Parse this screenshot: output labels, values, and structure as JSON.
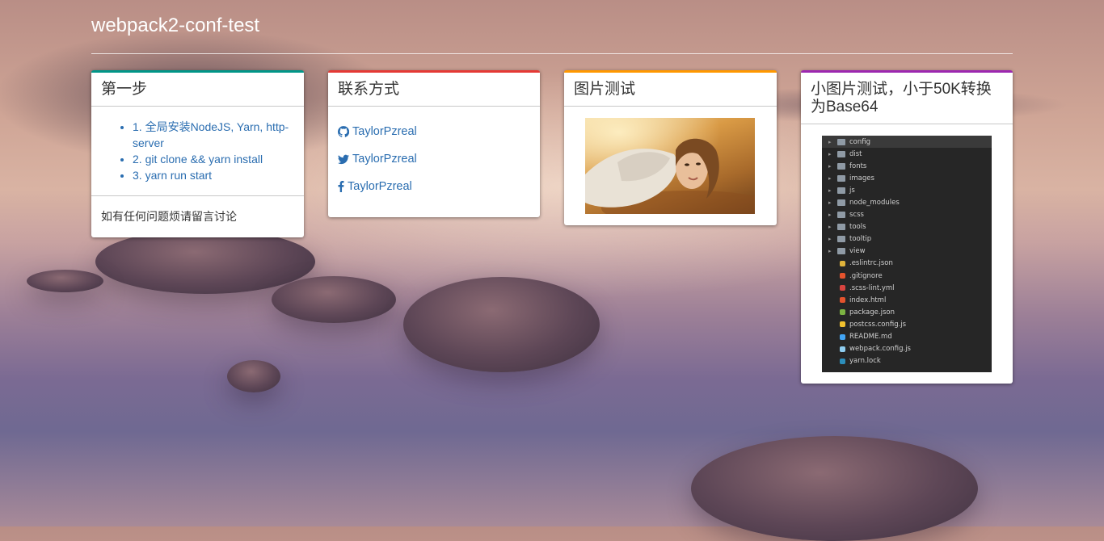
{
  "site": {
    "title": "webpack2-conf-test"
  },
  "colors": {
    "teal": "#009688",
    "red": "#e53935",
    "orange": "#ff9800",
    "purple": "#9c27b0",
    "link": "#2a6db0"
  },
  "card_steps": {
    "title": "第一步",
    "steps": [
      "1. 全局安装NodeJS, Yarn, http-server",
      "2. git clone && yarn install",
      "3. yarn run start"
    ],
    "footer": "如有任何问题烦请留言讨论"
  },
  "card_contact": {
    "title": "联系方式",
    "links": [
      {
        "icon": "github-icon",
        "label": "TaylorPzreal"
      },
      {
        "icon": "twitter-icon",
        "label": "TaylorPzreal"
      },
      {
        "icon": "facebook-icon",
        "label": "TaylorPzreal"
      }
    ]
  },
  "card_image": {
    "title": "图片测试"
  },
  "card_small_image": {
    "title": "小图片测试，小于50K转换为Base64",
    "file_tree": [
      {
        "name": "config",
        "type": "folder"
      },
      {
        "name": "dist",
        "type": "folder"
      },
      {
        "name": "fonts",
        "type": "folder"
      },
      {
        "name": "images",
        "type": "folder"
      },
      {
        "name": "js",
        "type": "folder"
      },
      {
        "name": "node_modules",
        "type": "folder"
      },
      {
        "name": "scss",
        "type": "folder"
      },
      {
        "name": "tools",
        "type": "folder"
      },
      {
        "name": "tooltip",
        "type": "folder"
      },
      {
        "name": "view",
        "type": "folder"
      },
      {
        "name": ".eslintrc.json",
        "type": "file",
        "icon_color": "#e0b33b"
      },
      {
        "name": ".gitignore",
        "type": "file",
        "icon_color": "#e5532d"
      },
      {
        "name": ".scss-lint.yml",
        "type": "file",
        "icon_color": "#d9443f"
      },
      {
        "name": "index.html",
        "type": "file",
        "icon_color": "#e5532d"
      },
      {
        "name": "package.json",
        "type": "file",
        "icon_color": "#7cb342"
      },
      {
        "name": "postcss.config.js",
        "type": "file",
        "icon_color": "#f2c12e"
      },
      {
        "name": "README.md",
        "type": "file",
        "icon_color": "#42a5f5"
      },
      {
        "name": "webpack.config.js",
        "type": "file",
        "icon_color": "#8ecdf0"
      },
      {
        "name": "yarn.lock",
        "type": "file",
        "icon_color": "#2c8ebb"
      }
    ]
  }
}
